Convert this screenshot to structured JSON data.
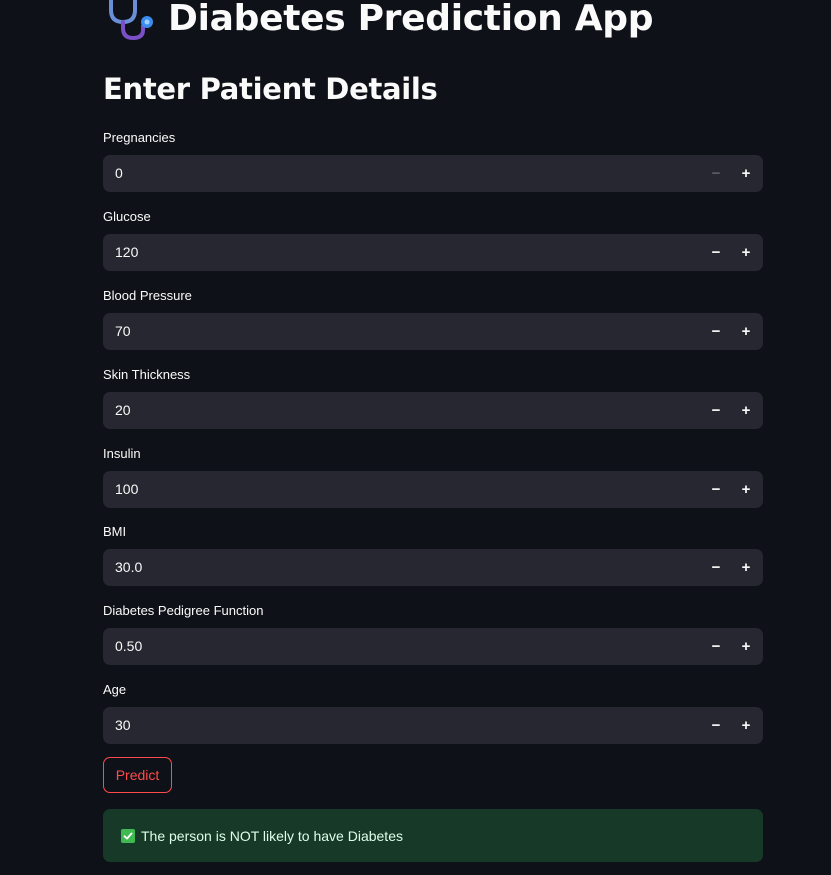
{
  "app": {
    "title": "Diabetes Prediction App",
    "icon": "stethoscope-icon"
  },
  "form": {
    "heading": "Enter Patient Details",
    "fields": [
      {
        "label": "Pregnancies",
        "value": "0",
        "minus_disabled": true
      },
      {
        "label": "Glucose",
        "value": "120"
      },
      {
        "label": "Blood Pressure",
        "value": "70"
      },
      {
        "label": "Skin Thickness",
        "value": "20"
      },
      {
        "label": "Insulin",
        "value": "100"
      },
      {
        "label": "BMI",
        "value": "30.0"
      },
      {
        "label": "Diabetes Pedigree Function",
        "value": "0.50"
      },
      {
        "label": "Age",
        "value": "30"
      }
    ],
    "minus_symbol": "−",
    "plus_symbol": "+"
  },
  "predict_button": {
    "label": "Predict"
  },
  "result": {
    "icon": "check-mark-icon",
    "message": "The person is NOT likely to have Diabetes"
  },
  "colors": {
    "background": "#0e1117",
    "input_background": "#262730",
    "accent": "#ff4b4b",
    "success_background": "#173928",
    "success_check": "#3fb950"
  }
}
